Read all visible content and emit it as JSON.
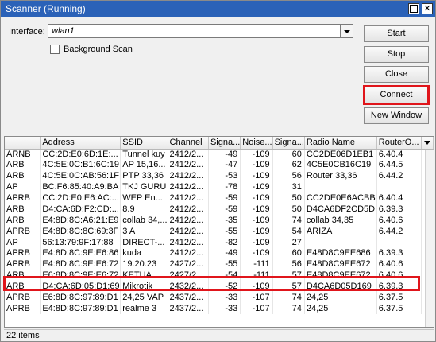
{
  "window": {
    "title": "Scanner (Running)"
  },
  "interface": {
    "label": "Interface:",
    "value": "wlan1"
  },
  "background_scan": {
    "label": "Background Scan",
    "checked": false
  },
  "buttons": {
    "start": "Start",
    "stop": "Stop",
    "close": "Close",
    "connect": "Connect",
    "new_window": "New Window"
  },
  "table": {
    "columns": [
      "",
      "Address",
      "SSID",
      "Channel",
      "Signa...",
      "Noise...",
      "Signa...",
      "Radio Name",
      "RouterO..."
    ],
    "rows": [
      [
        "ARNB",
        "CC:2D:E0:6D:1E:...",
        "Tunnel kuy",
        "2412/2...",
        "-49",
        "-109",
        "60",
        "CC2DE06D1EB1",
        "6.40.4"
      ],
      [
        "ARB",
        "4C:5E:0C:B1:6C:19",
        "AP 15,16...",
        "2412/2...",
        "-47",
        "-109",
        "62",
        "4C5E0CB16C19",
        "6.44.5"
      ],
      [
        "ARB",
        "4C:5E:0C:AB:56:1F",
        "PTP 33,36",
        "2412/2...",
        "-53",
        "-109",
        "56",
        "Router 33,36",
        "6.44.2"
      ],
      [
        "AP",
        "BC:F6:85:40:A9:BA",
        "TKJ GURU",
        "2412/2...",
        "-78",
        "-109",
        "31",
        "",
        ""
      ],
      [
        "APRB",
        "CC:2D:E0:E6:AC:...",
        "WEP En...",
        "2412/2...",
        "-59",
        "-109",
        "50",
        "CC2DE0E6ACBB",
        "6.40.4"
      ],
      [
        "ARB",
        "D4:CA:6D:F2:CD:...",
        "8.9",
        "2412/2...",
        "-59",
        "-109",
        "50",
        "D4CA6DF2CD5D",
        "6.39.3"
      ],
      [
        "ARB",
        "E4:8D:8C:A6:21:E9",
        "collab 34,...",
        "2412/2...",
        "-35",
        "-109",
        "74",
        "collab 34,35",
        "6.40.6"
      ],
      [
        "APRB",
        "E4:8D:8C:8C:69:3F",
        "3 A",
        "2412/2...",
        "-55",
        "-109",
        "54",
        "ARIZA",
        "6.44.2"
      ],
      [
        "AP",
        "56:13:79:9F:17:88",
        "DIRECT-...",
        "2412/2...",
        "-82",
        "-109",
        "27",
        "",
        ""
      ],
      [
        "APRB",
        "E4:8D:8C:9E:E6:86",
        "kuda",
        "2412/2...",
        "-49",
        "-109",
        "60",
        "E48D8C9EE686",
        "6.39.3"
      ],
      [
        "APRB",
        "E4:8D:8C:9E:E6:72",
        "19.20.23",
        "2427/2...",
        "-55",
        "-111",
        "56",
        "E48D8C9EE672",
        "6.40.6"
      ],
      [
        "ARB",
        "E6:8D:8C:9E:E6:72",
        "KETUA",
        "2427/2...",
        "-54",
        "-111",
        "57",
        "E48D8C9EE672",
        "6.40.6"
      ],
      [
        "ARB",
        "D4:CA:6D:05:D1:69",
        "Mikrotik",
        "2432/2...",
        "-52",
        "-109",
        "57",
        "D4CA6D05D169",
        "6.39.3"
      ],
      [
        "APRB",
        "E6:8D:8C:97:89:D1",
        "24,25 VAP",
        "2437/2...",
        "-33",
        "-107",
        "74",
        "24,25",
        "6.37.5"
      ],
      [
        "APRB",
        "E4:8D:8C:97:89:D1",
        "realme 3",
        "2437/2...",
        "-33",
        "-107",
        "74",
        "24,25",
        "6.37.5"
      ]
    ]
  },
  "status": {
    "items": "22 items"
  },
  "colors": {
    "titlebar": "#2b62b8",
    "highlight": "#e0151b"
  }
}
